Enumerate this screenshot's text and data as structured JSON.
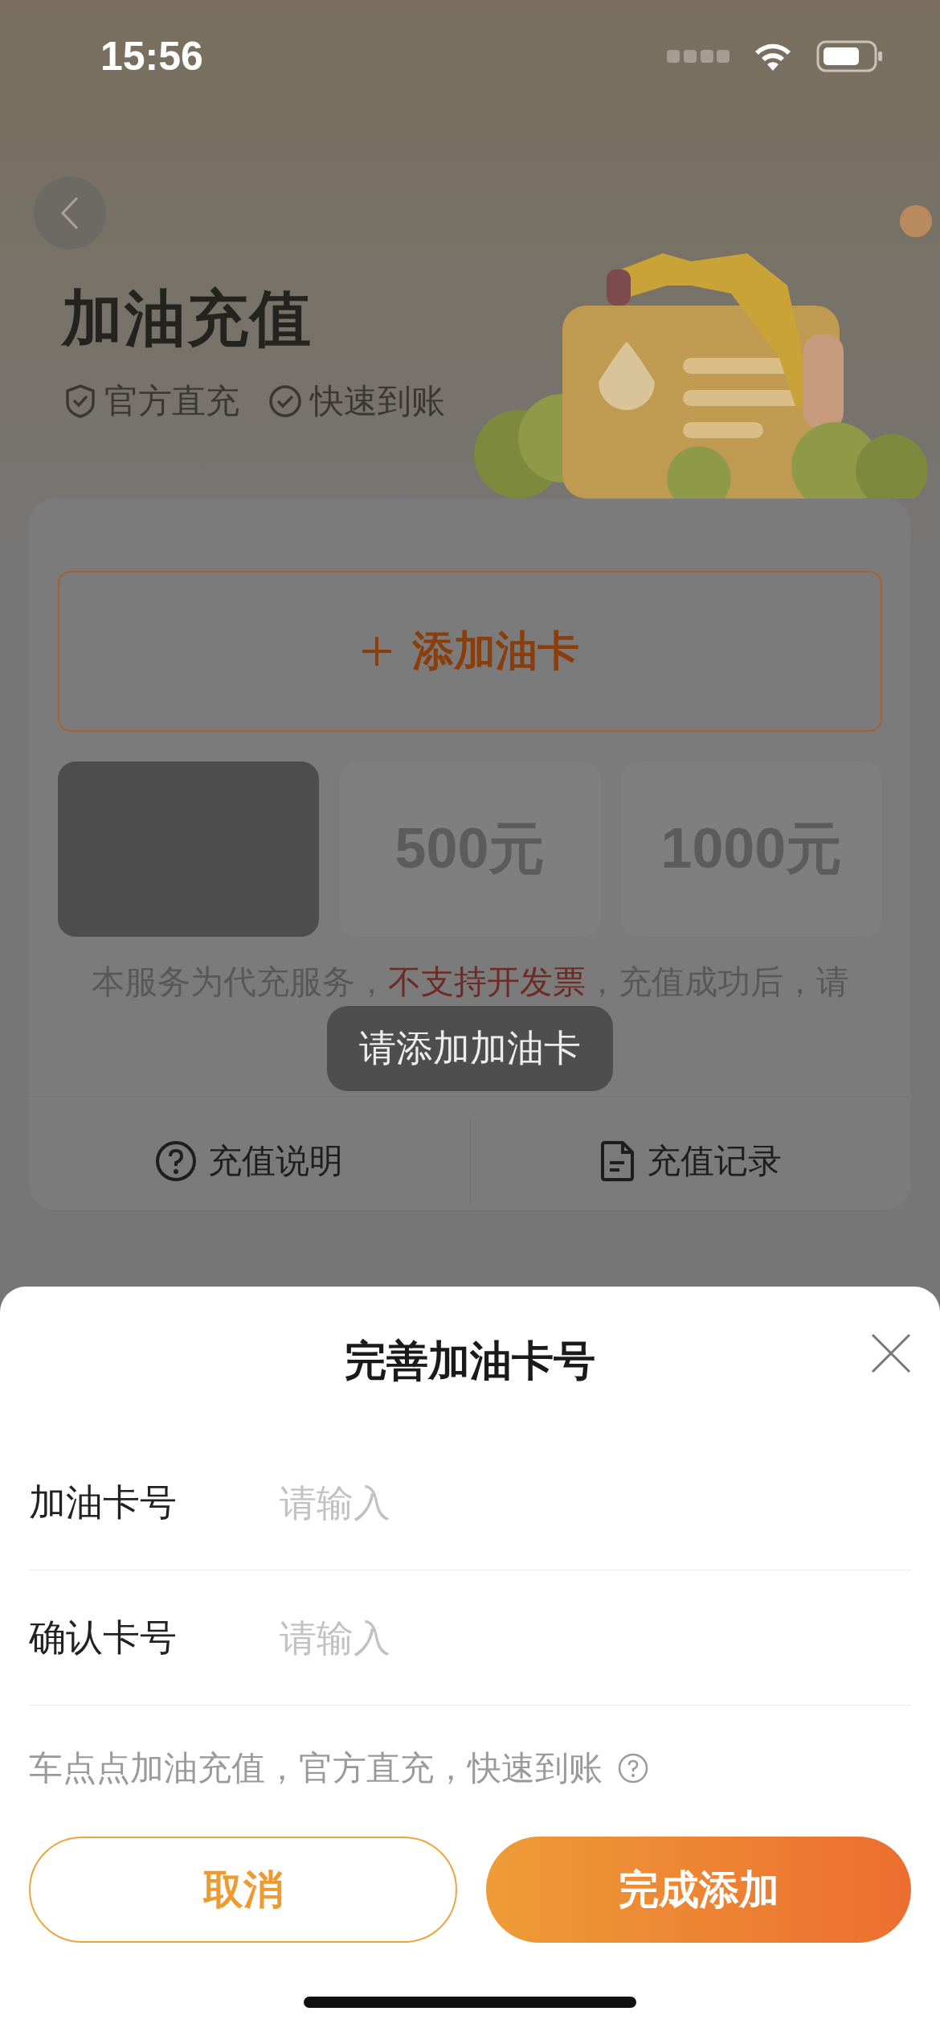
{
  "status_bar": {
    "time": "15:56"
  },
  "header": {
    "title": "加油充值",
    "badges": [
      {
        "kind": "shield",
        "text": "官方直充"
      },
      {
        "kind": "check",
        "text": "快速到账"
      }
    ]
  },
  "recharge_card": {
    "add_card_button": {
      "label": "添加油卡"
    },
    "amount_options": [
      {
        "selected": true
      },
      {
        "label": "500元",
        "selected": false
      },
      {
        "label": "1000元",
        "selected": false
      }
    ],
    "notice": "本服务为代充服务，**不支持开发票**，充值成功后，请",
    "links": [
      {
        "kind": "help",
        "label": "充值说明"
      },
      {
        "kind": "document",
        "label": "充值记录"
      }
    ]
  },
  "toast": "请添加加油卡",
  "sheet": {
    "title": "完善加油卡号",
    "fields": [
      {
        "label": "加油卡号",
        "placeholder": "请输入"
      },
      {
        "label": "确认卡号",
        "placeholder": "请输入"
      }
    ],
    "hint": "车点点加油充值，官方直充，快速到账",
    "buttons": [
      {
        "kind": "secondary",
        "label": "取消"
      },
      {
        "kind": "primary",
        "label": "完成添加"
      }
    ]
  }
}
